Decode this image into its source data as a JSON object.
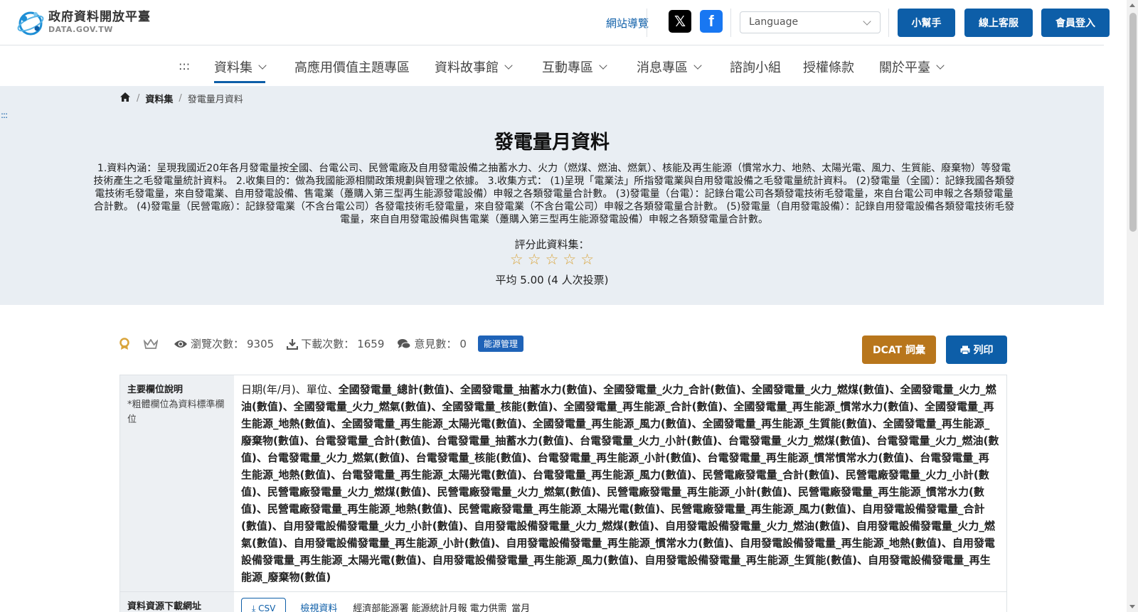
{
  "header": {
    "logo_title": "政府資料開放平臺",
    "logo_sub": "DATA.GOV.TW",
    "site_nav": "網站導覽",
    "language_placeholder": "Language",
    "help": "小幫手",
    "service": "線上客服",
    "login": "會員登入"
  },
  "nav": {
    "dots": ":::",
    "items": [
      "資料集",
      "高應用價值主題專區",
      "資料故事館",
      "互動專區",
      "消息專區",
      "諮詢小組",
      "授權條款",
      "關於平臺"
    ]
  },
  "breadcrumb": [
    "資料集",
    "發電量月資料"
  ],
  "side_dots": ":::",
  "dataset": {
    "title": "發電量月資料",
    "description": "1.資料內涵：呈現我國近20年各月發電量按全國、台電公司、民營電廠及自用發電設備之抽蓄水力、火力（燃煤、燃油、燃氣）、核能及再生能源（慣常水力、地熱、太陽光電、風力、生質能、廢棄物）等發電技術產生之毛發電量統計資料。 2.收集目的：做為我國能源相關政策規劃與管理之依據。 3.收集方式： (1)呈現「電業法」所指發電業與自用發電設備之毛發電量統計資料。 (2)發電量（全國）：記錄我國各類發電技術毛發電量，來自發電業、自用發電設備、售電業（躉購入第三型再生能源發電設備）申報之各類發電量合計數。 (3)發電量（台電）：記錄台電公司各類發電技術毛發電量，來自台電公司申報之各類發電量合計數。 (4)發電量（民營電廠）：記錄發電業（不含台電公司）各發電技術毛發電量，來自發電業（不含台電公司）申報之各類發電量合計數。 (5)發電量（自用發電設備）：記錄自用發電設備各類發電技術毛發電量，來自自用發電設備與售電業（躉購入第三型再生能源發電設備）申報之各類發電量合計數。",
    "rate_label": "評分此資料集：",
    "rating_value": 0,
    "avg_text": "平均 5.00 (4 人次投票)"
  },
  "stats": {
    "views_label": "瀏覽次數：",
    "views": "9305",
    "downloads_label": "下載次數：",
    "downloads": "1659",
    "comments_label": "意見數：",
    "comments": "0",
    "tag": "能源管理",
    "dcat": "DCAT 詞彙",
    "print": "列印"
  },
  "table": {
    "fields_label": "主要欄位說明",
    "fields_note": "*粗體欄位為資料標準欄位",
    "fields_plain": "日期(年/月)、單位、",
    "fields_bold": "全國發電量_總計(數值)、全國發電量_抽蓄水力(數值)、全國發電量_火力_合計(數值)、全國發電量_火力_燃煤(數值)、全國發電量_火力_燃油(數值)、全國發電量_火力_燃氣(數值)、全國發電量_核能(數值)、全國發電量_再生能源_合計(數值)、全國發電量_再生能源_慣常水力(數值)、全國發電量_再生能源_地熱(數值)、全國發電量_再生能源_太陽光電(數值)、全國發電量_再生能源_風力(數值)、全國發電量_再生能源_生質能(數值)、全國發電量_再生能源_廢棄物(數值)、台電發電量_合計(數值)、台電發電量_抽蓄水力(數值)、台電發電量_火力_小計(數值)、台電發電量_火力_燃煤(數值)、台電發電量_火力_燃油(數值)、台電發電量_火力_燃氣(數值)、台電發電量_核能(數值)、台電發電量_再生能源_小計(數值)、台電發電量_再生能源_慣常慣常水力(數值)、台電發電量_再生能源_地熱(數值)、台電發電量_再生能源_太陽光電(數值)、台電發電量_再生能源_風力(數值)、民營電廠發電量_合計(數值)、民營電廠發電量_火力_小計(數值)、民營電廠發電量_火力_燃煤(數值)、民營電廠發電量_火力_燃氣(數值)、民營電廠發電量_再生能源_小計(數值)、民營電廠發電量_再生能源_慣常水力(數值)、民營電廠發電量_再生能源_地熱(數值)、民營電廠發電量_再生能源_太陽光電(數值)、民營電廠發電量_再生能源_風力(數值)、自用發電設備發電量_合計(數值)、自用發電設備發電量_火力_小計(數值)、自用發電設備發電量_火力_燃煤(數值)、自用發電設備發電量_火力_燃油(數值)、自用發電設備發電量_火力_燃氣(數值)、自用發電設備發電量_再生能源_小計(數值)、自用發電設備發電量_再生能源_慣常水力(數值)、自用發電設備發電量_再生能源_地熱(數值)、自用發電設備發電量_再生能源_太陽光電(數值)、自用發電設備發電量_再生能源_風力(數值)、自用發電設備發電量_再生能源_生質能(數值)、自用發電設備發電量_再生能源_廢棄物(數值)",
    "download_label": "資料資源下載網址",
    "csv": "⤓ CSV",
    "preview": "檢視資料",
    "resource_desc": "經濟部能源署 能源統計月報 電力供需_當月"
  },
  "colors": {
    "brand": "#0d5ea8",
    "hero_bg": "#e9eef3",
    "dcat": "#b8761c",
    "badge": "#1f63b8",
    "star": "#d9a43a"
  }
}
